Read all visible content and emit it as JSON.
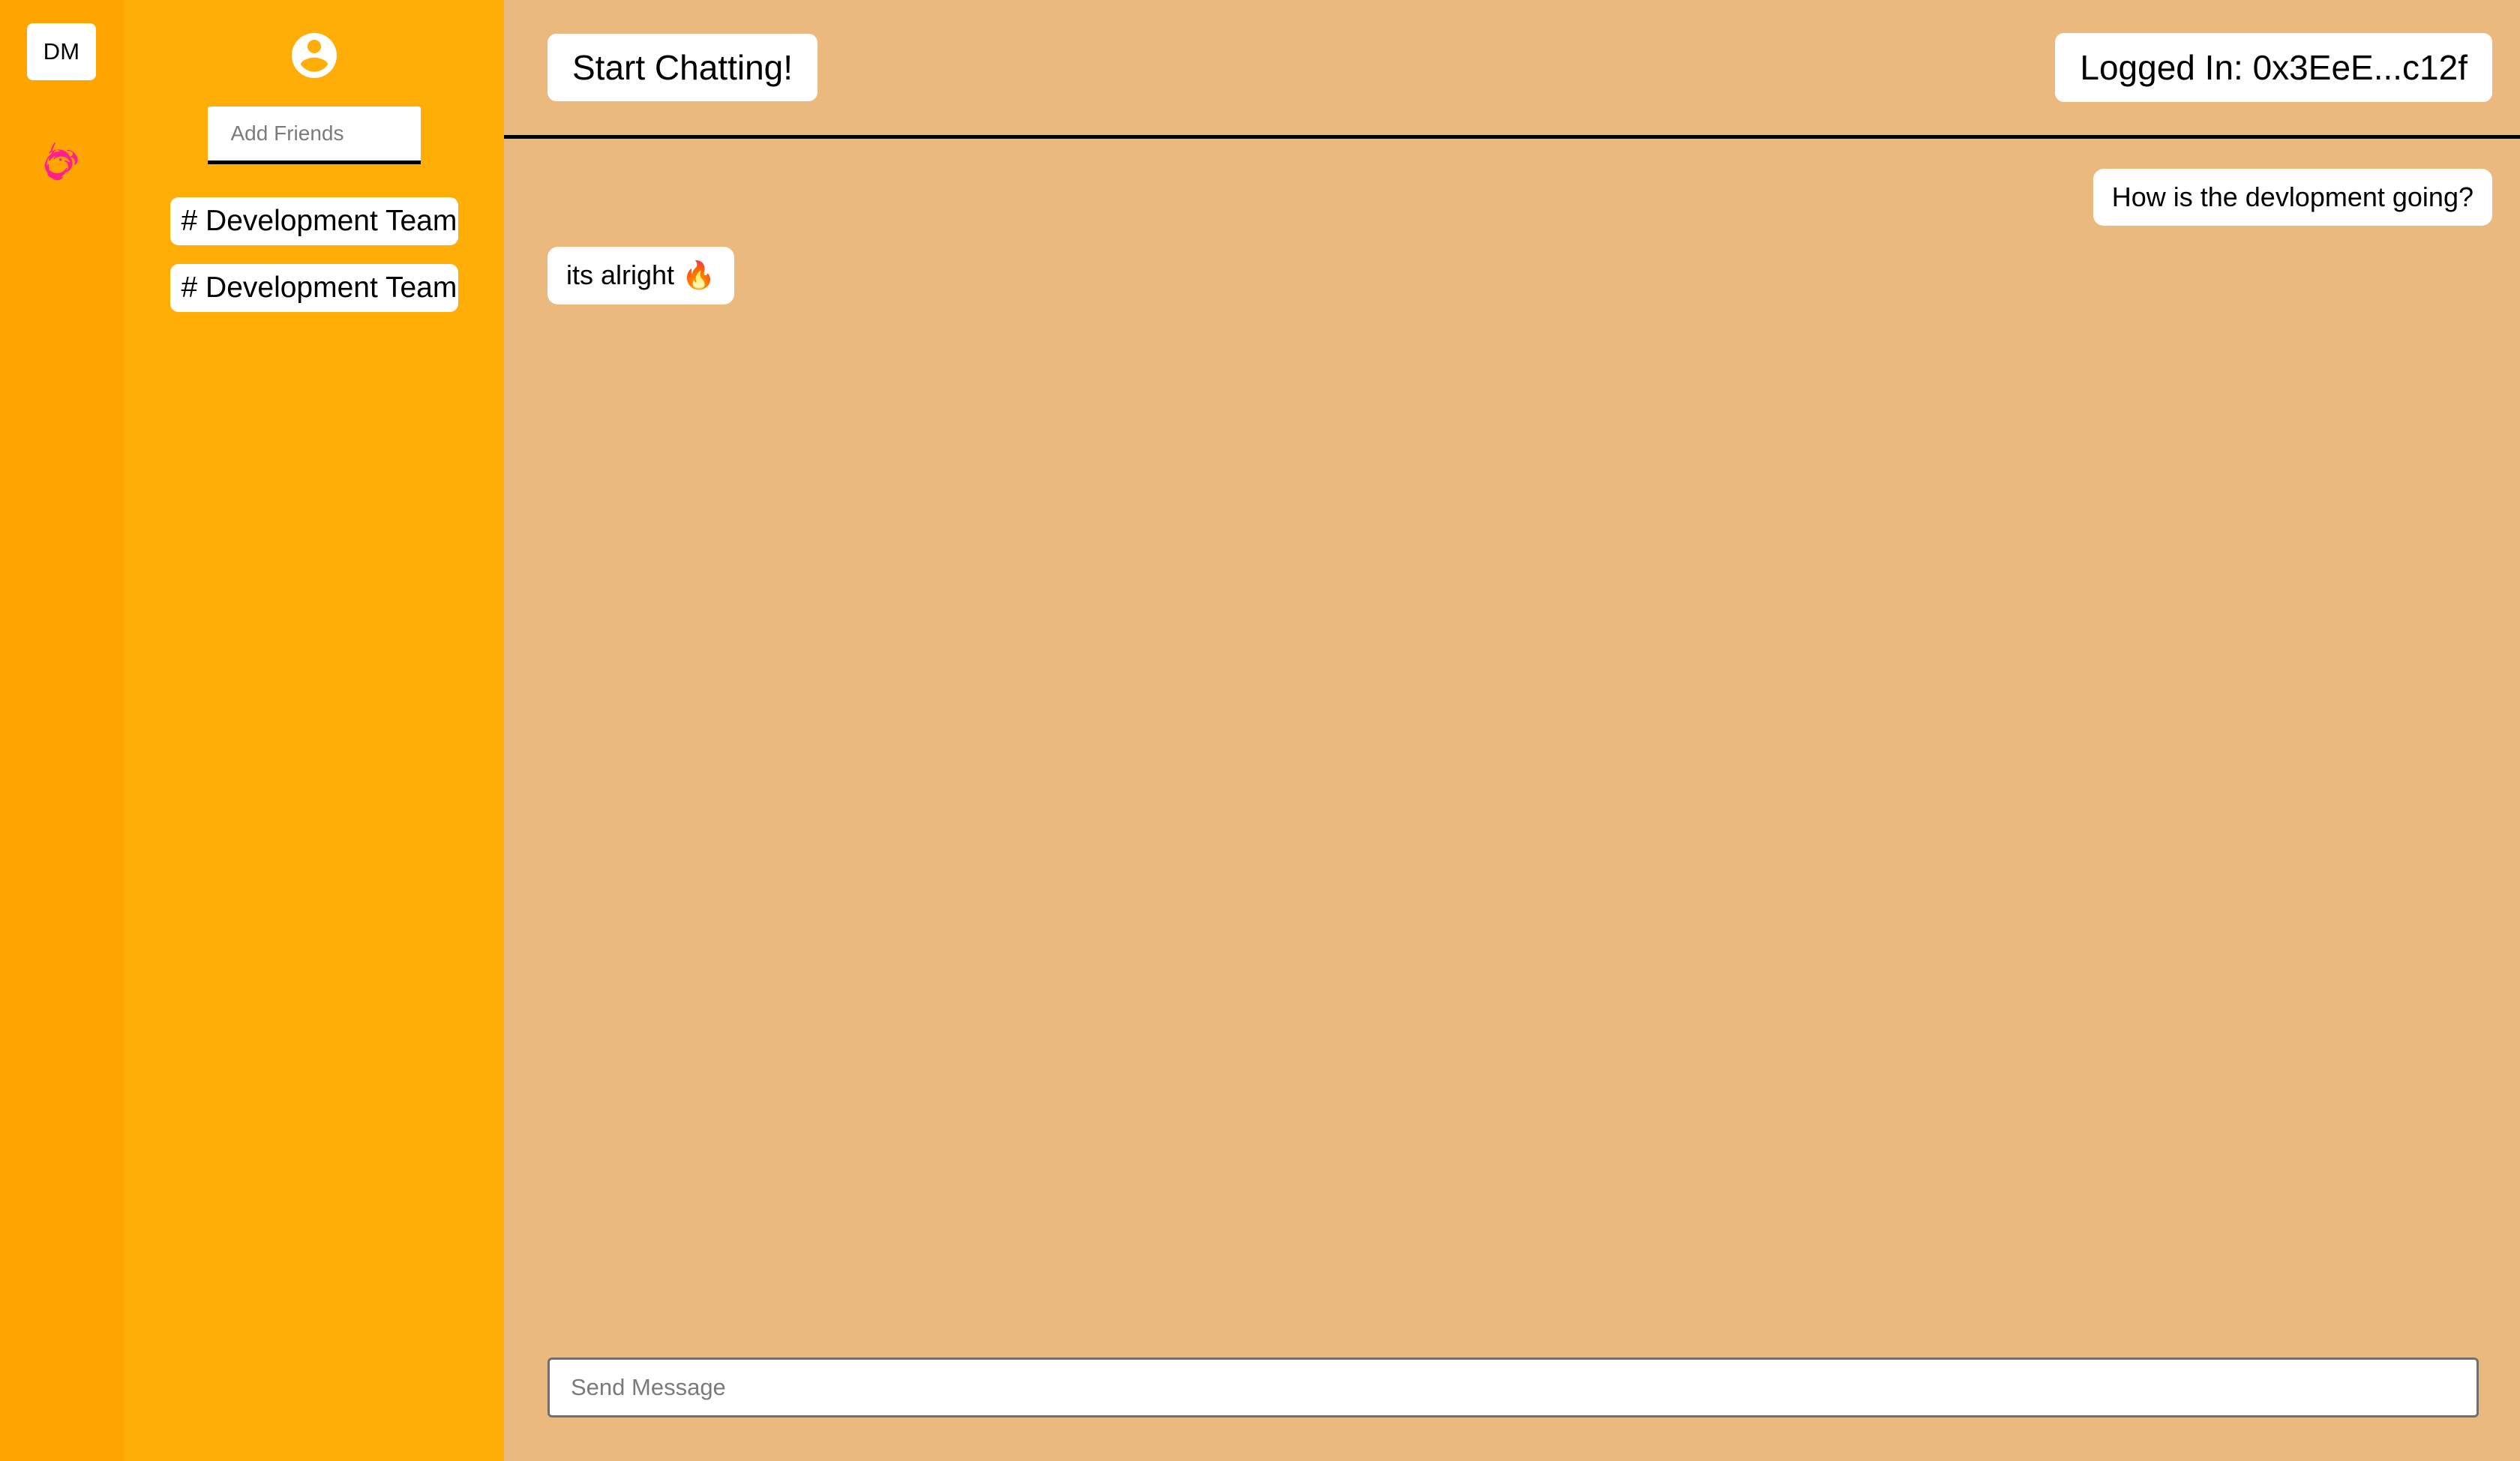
{
  "theme": {
    "rail_bg": "#FFA500",
    "sidebar_bg": "#FFAE08",
    "main_bg": "#EBB87D",
    "surface": "#FFFFFF",
    "text": "#000000",
    "divider": "#000000",
    "unicorn_pink": "#FF1F8E"
  },
  "rail": {
    "dm_label": "DM",
    "logo_icon": "unicorn-icon"
  },
  "sidebar": {
    "avatar_icon": "account-circle-icon",
    "add_friends": {
      "placeholder": "Add Friends",
      "value": ""
    },
    "channels": [
      {
        "label": "# Development Team"
      },
      {
        "label": "# Development Team"
      }
    ]
  },
  "topbar": {
    "start_chatting_label": "Start Chatting!",
    "login_status": "Logged In: 0x3EeE...c12f"
  },
  "chat": {
    "messages": [
      {
        "text": "How is the devlopment going?",
        "align": "right"
      },
      {
        "text": "its alright 🔥",
        "align": "left"
      }
    ]
  },
  "composer": {
    "placeholder": "Send Message",
    "value": ""
  }
}
